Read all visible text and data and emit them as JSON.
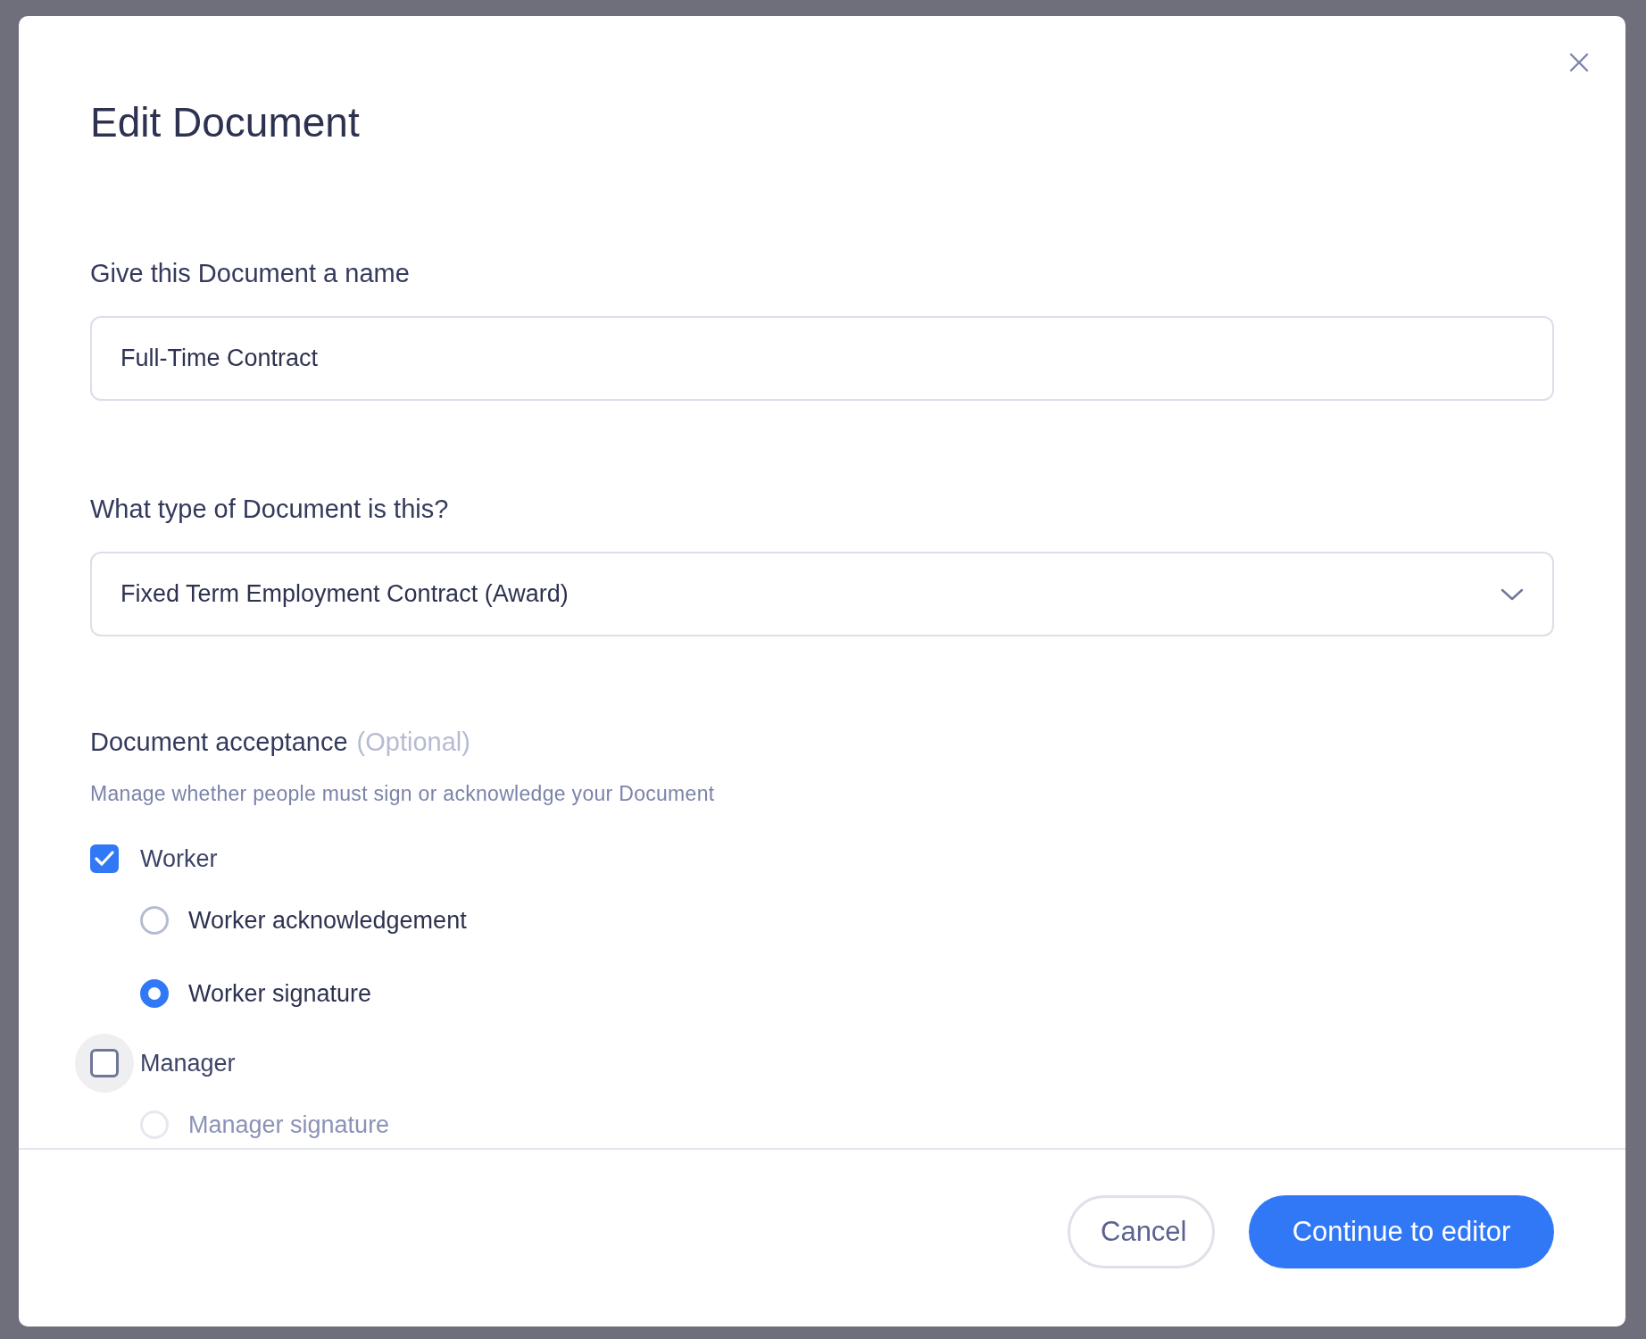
{
  "dialog": {
    "title": "Edit Document",
    "name_field": {
      "label": "Give this Document a name",
      "value": "Full-Time Contract"
    },
    "type_field": {
      "label": "What type of Document is this?",
      "value": "Fixed Term Employment Contract (Award)"
    },
    "acceptance": {
      "label": "Document acceptance",
      "optional": "(Optional)",
      "description": "Manage whether people must sign or acknowledge your Document",
      "parties": [
        {
          "label": "Worker",
          "checked": true,
          "focused": false,
          "options": [
            {
              "label": "Worker acknowledgement",
              "selected": false,
              "disabled": false
            },
            {
              "label": "Worker signature",
              "selected": true,
              "disabled": false
            }
          ]
        },
        {
          "label": "Manager",
          "checked": false,
          "focused": true,
          "options": [
            {
              "label": "Manager signature",
              "selected": false,
              "disabled": true
            }
          ]
        }
      ]
    },
    "buttons": [
      {
        "label": "Cancel",
        "kind": "secondary"
      },
      {
        "label": "Continue to editor",
        "kind": "primary"
      }
    ]
  }
}
